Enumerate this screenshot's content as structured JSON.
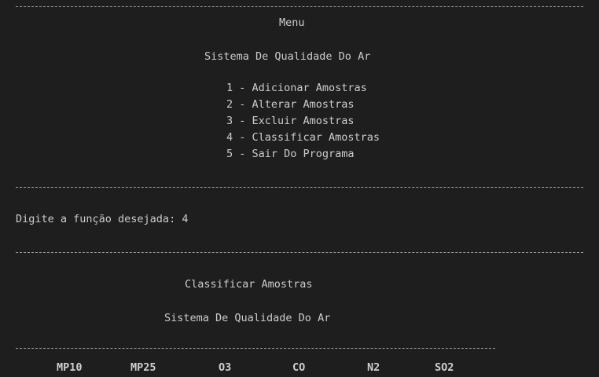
{
  "menu": {
    "title": "Menu",
    "system_name": "Sistema De Qualidade Do Ar",
    "items": [
      "1 - Adicionar Amostras",
      "2 - Alterar Amostras",
      "3 - Excluir Amostras",
      "4 - Classificar Amostras",
      "5 - Sair Do Programa"
    ]
  },
  "prompt": {
    "text": "Digite a função desejada: 4"
  },
  "classify": {
    "title": "Classificar Amostras",
    "system_name": "Sistema De Qualidade Do Ar",
    "table_headers": [
      "MP10",
      "MP25",
      "O3",
      "CO",
      "N2",
      "SO2"
    ]
  },
  "colors": {
    "background": "#1e1e1e",
    "foreground": "#cccccc"
  }
}
